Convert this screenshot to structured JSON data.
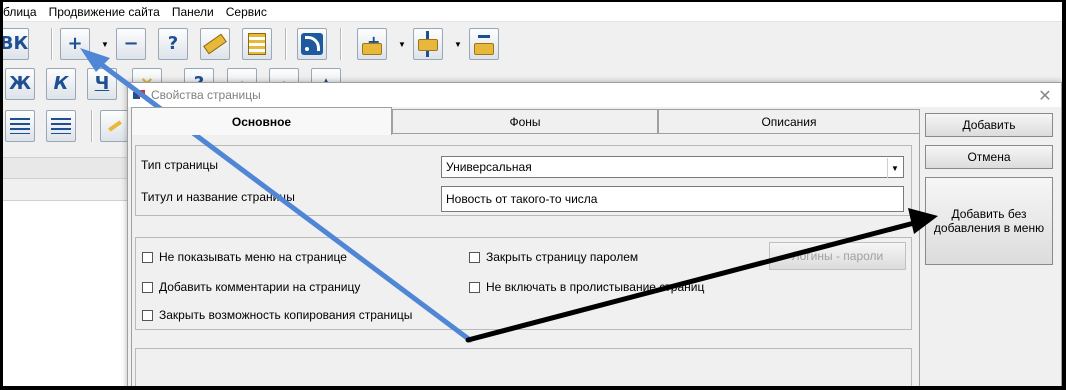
{
  "menubar": {
    "items": [
      "блица",
      "Продвижение сайта",
      "Панели",
      "Сервис"
    ]
  },
  "toolbar": {
    "row1": {
      "vk_btn": "ВК",
      "add_page_btn": "+",
      "remove_page_btn": "−",
      "help_btn": "?"
    },
    "row2": {
      "bold_btn": "Ж",
      "italic_btn": "К",
      "underline_btn": "Ч",
      "help_btn": "?"
    }
  },
  "dialog": {
    "title": "Свойства страницы",
    "close": "✕",
    "tabs": [
      "Основное",
      "Фоны",
      "Описания"
    ],
    "active_tab": "Основное",
    "page_type": {
      "label": "Тип страницы",
      "value": "Универсальная"
    },
    "page_title": {
      "label": "Титул и название страницы",
      "value": "Новость от такого-то числа"
    },
    "options_left": [
      "Не показывать меню на странице",
      "Добавить комментарии на страницу",
      "Закрыть возможность копирования страницы"
    ],
    "options_right": [
      "Закрыть страницу паролем",
      "Не включать в пролистывание страниц"
    ],
    "logins_btn": "Логины - пароли",
    "buttons": {
      "add": "Добавить",
      "cancel": "Отмена",
      "add_without_menu": "Добавить без добавления в меню"
    }
  },
  "colors": {
    "arrow_blue": "#4f87d6",
    "arrow_black": "#000000"
  }
}
